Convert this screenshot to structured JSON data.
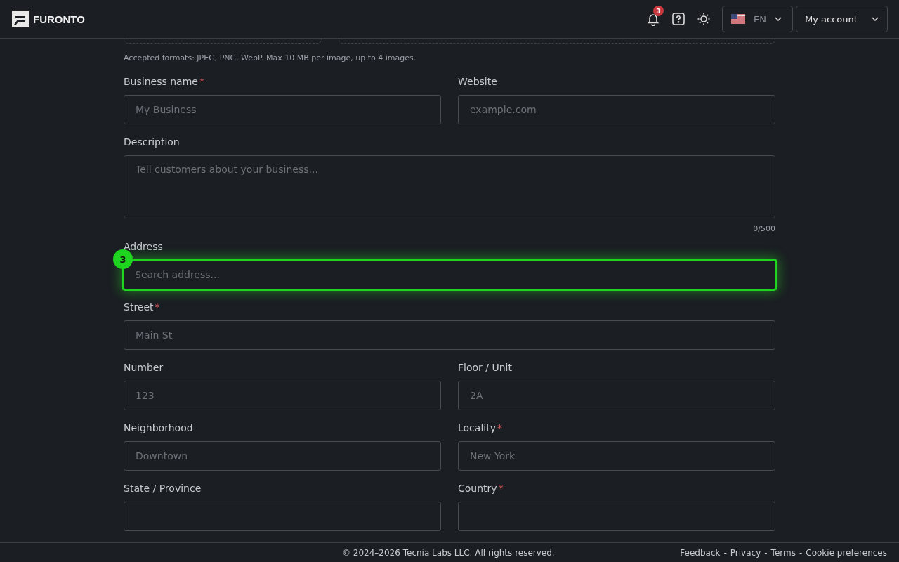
{
  "header": {
    "logo": "FURONTO",
    "notifications": {
      "count": "3"
    },
    "language": {
      "code": "EN"
    },
    "account": {
      "label": "My account"
    }
  },
  "upload": {
    "hint": "Accepted formats: JPEG, PNG, WebP. Max 10 MB per image, up to 4 images."
  },
  "form_rows": [
    {
      "fields": [
        {
          "kind": "input",
          "label": "Business name",
          "required_mark": "*",
          "placeholder": "My Business"
        },
        {
          "kind": "input",
          "label": "Website",
          "placeholder": "example.com"
        }
      ]
    },
    {
      "fields": [
        {
          "kind": "textarea",
          "label": "Description",
          "placeholder": "Tell customers about your business...",
          "counter": "0/500"
        }
      ]
    },
    {
      "fields": [
        {
          "kind": "input",
          "label": "Address",
          "placeholder": "Search address...",
          "highlighted": true,
          "step": "3"
        }
      ]
    },
    {
      "fields": [
        {
          "kind": "input",
          "label": "Street",
          "required_mark": "*",
          "placeholder": "Main St"
        }
      ]
    },
    {
      "fields": [
        {
          "kind": "input",
          "label": "Number",
          "placeholder": "123"
        },
        {
          "kind": "input",
          "label": "Floor / Unit",
          "placeholder": "2A"
        }
      ]
    },
    {
      "fields": [
        {
          "kind": "input",
          "label": "Neighborhood",
          "placeholder": "Downtown"
        },
        {
          "kind": "input",
          "label": "Locality",
          "required_mark": "*",
          "placeholder": "New York"
        }
      ]
    },
    {
      "fields": [
        {
          "kind": "input",
          "label": "State / Province"
        },
        {
          "kind": "select",
          "label": "Country",
          "required_mark": "*"
        }
      ]
    }
  ],
  "footer": {
    "copyright": "© 2024–2026 Tecnia Labs LLC. All rights reserved.",
    "links": [
      "Feedback",
      "Privacy",
      "Terms",
      "Cookie preferences"
    ],
    "separator": "-"
  }
}
